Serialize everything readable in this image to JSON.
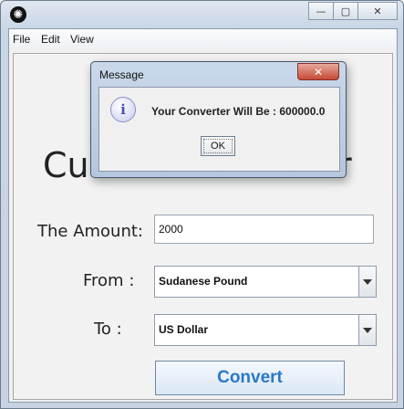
{
  "menu": {
    "file": "File",
    "edit": "Edit",
    "view": "View"
  },
  "main": {
    "title_left": "Cur",
    "title_right": "r",
    "amount_label": "The Amount:",
    "amount_value": "2000",
    "from_label": "From  :",
    "from_value": "Sudanese Pound",
    "to_label": "To   :",
    "to_value": "US Dollar",
    "convert_label": "Convert"
  },
  "dialog": {
    "title": "Message",
    "close": "✕",
    "info_glyph": "i",
    "message": "Your Converter Will Be : 600000.0",
    "ok_label": "OK"
  },
  "window_buttons": {
    "minimize": "—",
    "maximize": "▢",
    "close": "✕"
  }
}
